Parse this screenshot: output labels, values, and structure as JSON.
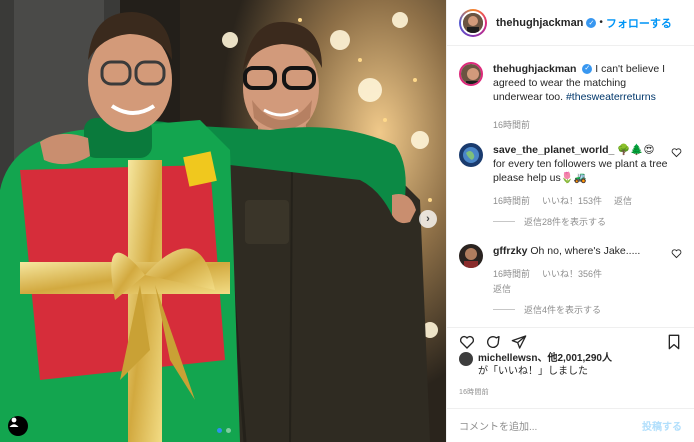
{
  "post": {
    "username": "thehughjackman",
    "verified_mark": "✓",
    "separator": "•",
    "follow_label": "フォローする"
  },
  "comments": [
    {
      "username": "thehughjackman",
      "text": "I can't believe I agreed to wear the matching underwear too.",
      "hashtag": "#thesweaterreturns",
      "time": "16時間前"
    },
    {
      "username": "save_the_planet_world_",
      "text": "🌳🌲😍 for every ten followers we plant a tree please help us🌷🚜",
      "time": "16時間前",
      "likes": "いいね！153件",
      "reply_label": "返信",
      "view_replies": "返信28件を表示する"
    },
    {
      "username": "gffrzky",
      "text": "Oh no, where's Jake.....",
      "time": "16時間前",
      "likes": "いいね！356件",
      "reply_label": "返信",
      "view_replies": "返信4件を表示する"
    }
  ],
  "likes_summary": {
    "user": "michellewsn",
    "rest": "、他2,001,290人",
    "line2": "が「いいね！」しました"
  },
  "timestamp": "16時間前",
  "add_comment": {
    "placeholder": "コメントを追加...",
    "post_label": "投稿する"
  },
  "carousel": {
    "current": 1,
    "total": 2,
    "next_glyph": "›"
  },
  "icons": [
    "heart-icon",
    "comment-icon",
    "share-icon",
    "bookmark-icon",
    "user-tag-icon",
    "verified-icon"
  ],
  "colors": {
    "link": "#0095f6",
    "hashtag": "#00376b",
    "muted": "#8e8e8e",
    "active_dot": "#2f8ff0",
    "verified": "#3897f0"
  }
}
